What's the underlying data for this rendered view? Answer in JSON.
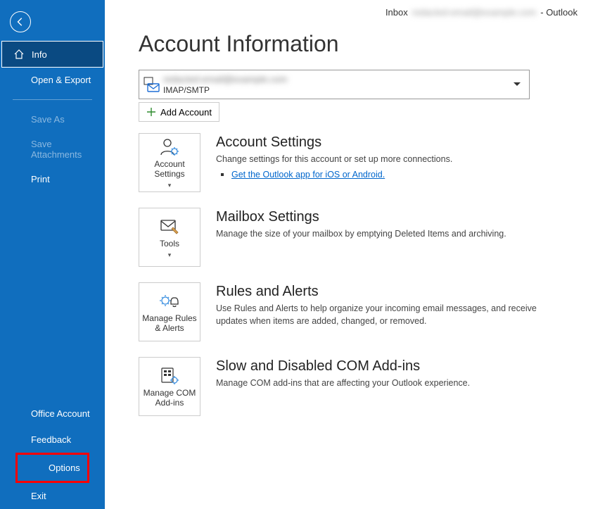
{
  "titlebar": {
    "context": "Inbox",
    "email_blur": "redacted-email@example.com",
    "suffix": "-  Outlook"
  },
  "sidebar": {
    "info": "Info",
    "open_export": "Open & Export",
    "save_as": "Save As",
    "save_attachments": "Save Attachments",
    "print": "Print",
    "office_account": "Office Account",
    "feedback": "Feedback",
    "options": "Options",
    "exit": "Exit"
  },
  "page": {
    "title": "Account Information",
    "account_email_blur": "redacted-email@example.com",
    "account_protocol": "IMAP/SMTP",
    "add_account": "Add Account"
  },
  "sections": {
    "account_settings": {
      "tile_label": "Account Settings",
      "heading": "Account Settings",
      "desc": "Change settings for this account or set up more connections.",
      "link": "Get the Outlook app for iOS or Android."
    },
    "mailbox": {
      "tile_label": "Tools",
      "heading": "Mailbox Settings",
      "desc": "Manage the size of your mailbox by emptying Deleted Items and archiving."
    },
    "rules": {
      "tile_label": "Manage Rules & Alerts",
      "heading": "Rules and Alerts",
      "desc": "Use Rules and Alerts to help organize your incoming email messages, and receive updates when items are added, changed, or removed."
    },
    "addins": {
      "tile_label": "Manage COM Add-ins",
      "heading": "Slow and Disabled COM Add-ins",
      "desc": "Manage COM add-ins that are affecting your Outlook experience."
    }
  }
}
